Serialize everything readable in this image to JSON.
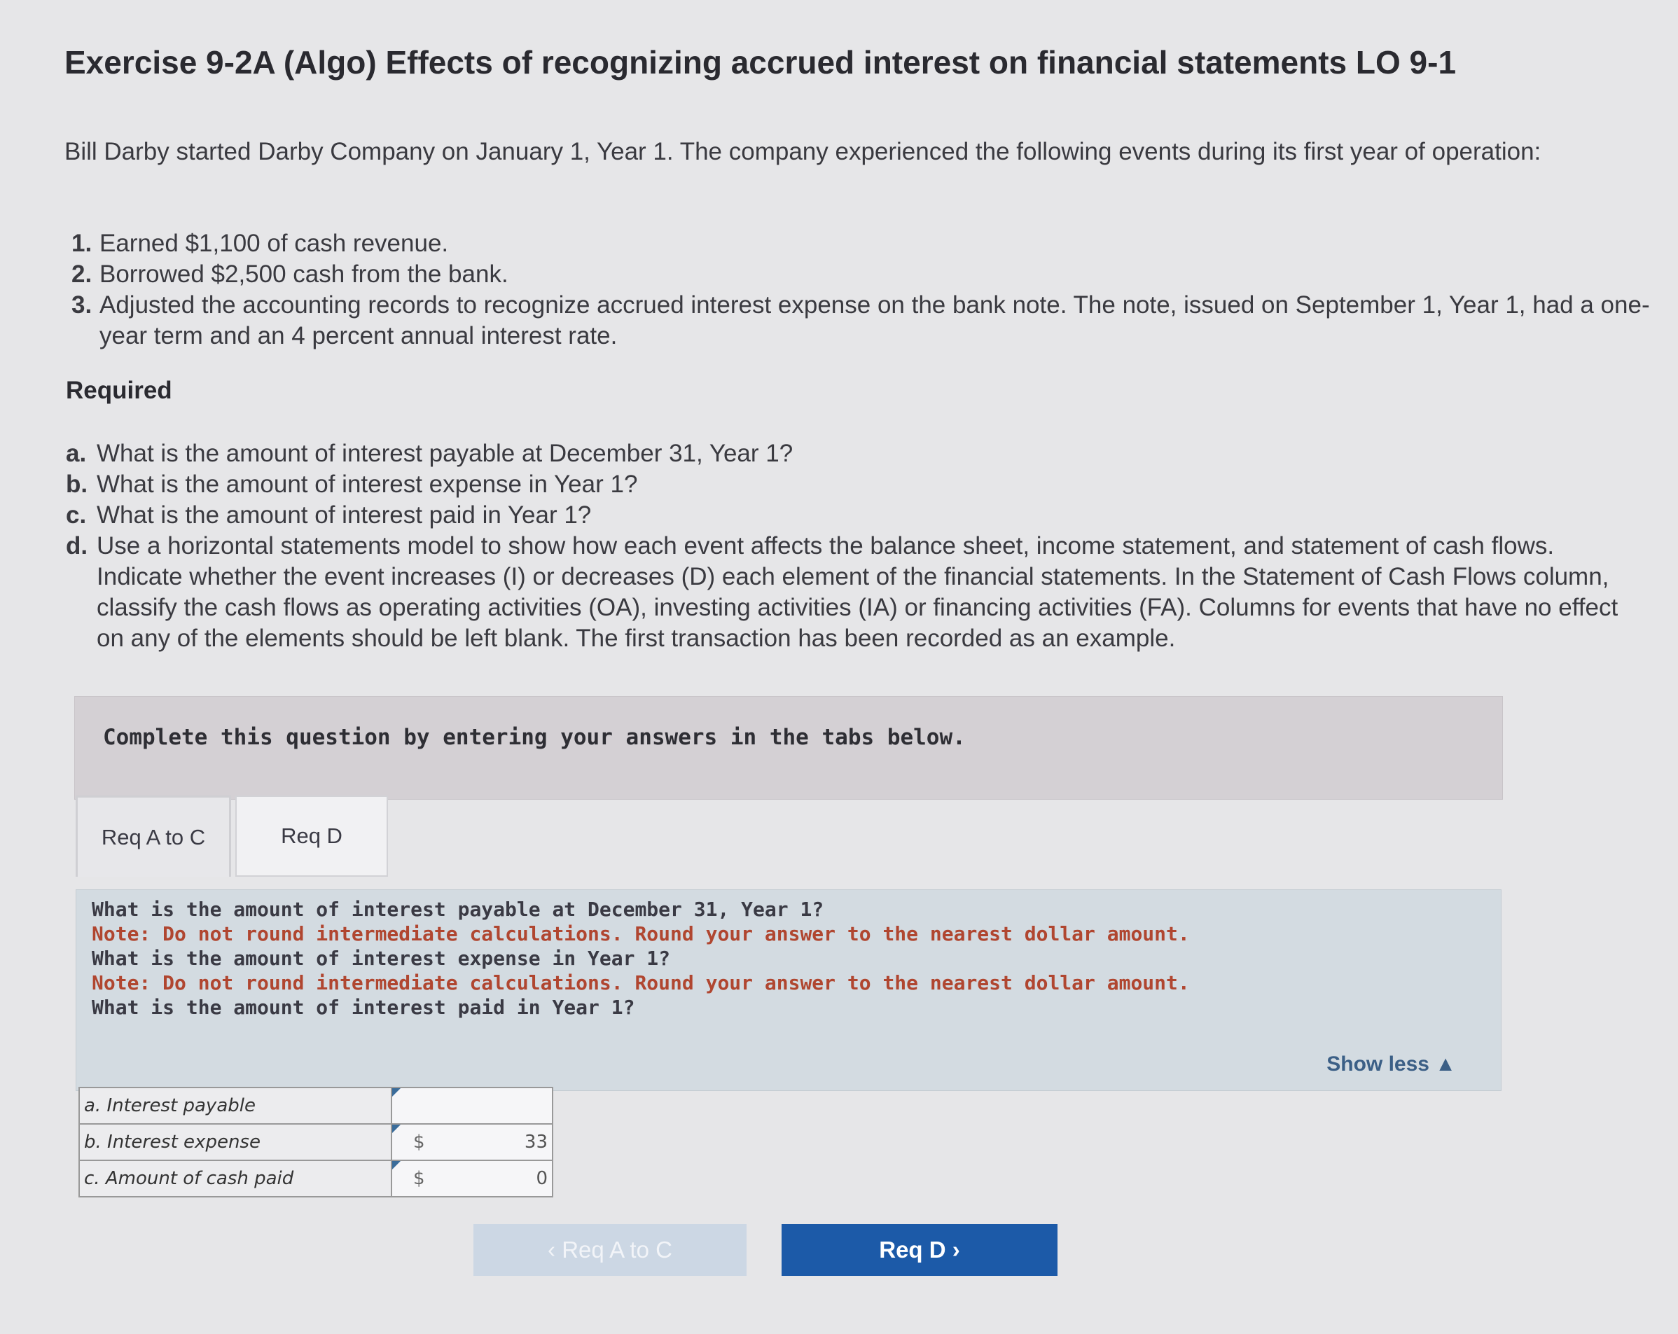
{
  "header": {
    "title": "Exercise 9-2A (Algo) Effects of recognizing accrued interest on financial statements LO 9-1"
  },
  "problem": {
    "intro": "Bill Darby started Darby Company on January 1, Year 1. The company experienced the following events during its first year of operation:",
    "events": [
      {
        "num": "1.",
        "text": "Earned $1,100 of cash revenue."
      },
      {
        "num": "2.",
        "text": "Borrowed $2,500 cash from the bank."
      },
      {
        "num": "3.",
        "text": "Adjusted the accounting records to recognize accrued interest expense on the bank note. The note, issued on September 1, Year 1, had a one-year term and an 4 percent annual interest rate."
      }
    ],
    "required_label": "Required",
    "requirements": [
      {
        "num": "a.",
        "text": "What is the amount of interest payable at December 31, Year 1?"
      },
      {
        "num": "b.",
        "text": "What is the amount of interest expense in Year 1?"
      },
      {
        "num": "c.",
        "text": "What is the amount of interest paid in Year 1?"
      },
      {
        "num": "d.",
        "text": "Use a horizontal statements model to show how each event affects the balance sheet, income statement, and statement of cash flows. Indicate whether the event increases (I) or decreases (D) each element of the financial statements. In the Statement of Cash Flows column, classify the cash flows as operating activities (OA), investing activities (IA) or financing activities (FA). Columns for events that have no effect on any of the elements should be left blank. The first transaction has been recorded as an example."
      }
    ]
  },
  "instruction": "Complete this question by entering your answers in the tabs below.",
  "tabs": [
    {
      "label": "Req A to C",
      "active": true
    },
    {
      "label": "Req D",
      "active": false
    }
  ],
  "panel": {
    "line1": "What is the amount of interest payable at December 31, Year 1?",
    "note1": "Note: Do not round intermediate calculations. Round your answer to the nearest dollar amount.",
    "line2": "What is the amount of interest expense in Year 1?",
    "note2": "Note: Do not round intermediate calculations. Round your answer to the nearest dollar amount.",
    "line3": "What is the amount of interest paid in Year 1?",
    "show_less": "Show less ▲"
  },
  "answers": [
    {
      "label": "a. Interest payable",
      "currency": "",
      "value": ""
    },
    {
      "label": "b. Interest expense",
      "currency": "$",
      "value": "33"
    },
    {
      "label": "c. Amount of cash paid",
      "currency": "$",
      "value": "0"
    }
  ],
  "nav": {
    "prev_label": "‹  Req A to C",
    "next_label": "Req D  ›"
  }
}
